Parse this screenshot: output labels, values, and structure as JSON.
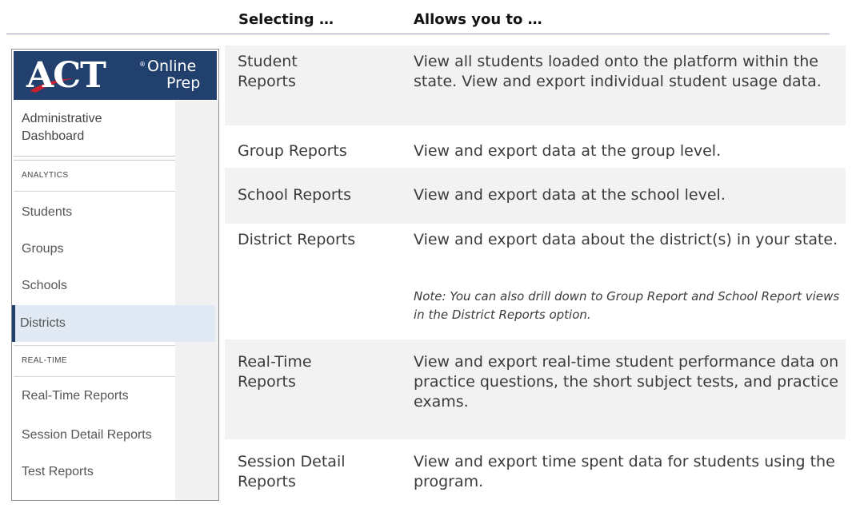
{
  "header": {
    "col1": "Selecting …",
    "col2": "Allows you to …"
  },
  "sidebar": {
    "logo": {
      "brand": "ACT",
      "word1": "Online",
      "word2": "Prep",
      "reg_mark": "®",
      "background": "#22406e",
      "accent": "#c8202f"
    },
    "title_line1": "Administrative",
    "title_line2": "Dashboard",
    "section_analytics": "ANALYTICS",
    "section_realtime": "REAL-TIME",
    "items": [
      {
        "label": "Students",
        "active": false
      },
      {
        "label": "Groups",
        "active": false
      },
      {
        "label": "Schools",
        "active": false
      },
      {
        "label": "Districts",
        "active": true
      },
      {
        "label": "Real-Time Reports",
        "active": false
      },
      {
        "label": "Session Detail Reports",
        "active": false
      },
      {
        "label": "Test Reports",
        "active": false
      }
    ]
  },
  "rows": [
    {
      "selecting": "Student Reports",
      "allows": "View all students loaded onto the platform within the state. View and export individual student usage data."
    },
    {
      "selecting": "Group Reports",
      "allows": "View and export data at the group level."
    },
    {
      "selecting": "School Reports",
      "allows": "View and export data at the school level."
    },
    {
      "selecting": "District Reports",
      "allows": "View and export data about the district(s) in your state.",
      "note": "Note: You can also drill down to Group Report and School Report views in the District Reports option."
    },
    {
      "selecting": "Real-Time Reports",
      "allows": "View and export real-time student performance data on practice questions, the short subject tests, and practice exams."
    },
    {
      "selecting": "Session Detail Reports",
      "allows": "View and export time spent data for students using the program."
    }
  ],
  "colors": {
    "header_rule": "#a89ac4",
    "row_shade": "#f2f2f2",
    "active_item_bg": "#e1eaf4"
  }
}
